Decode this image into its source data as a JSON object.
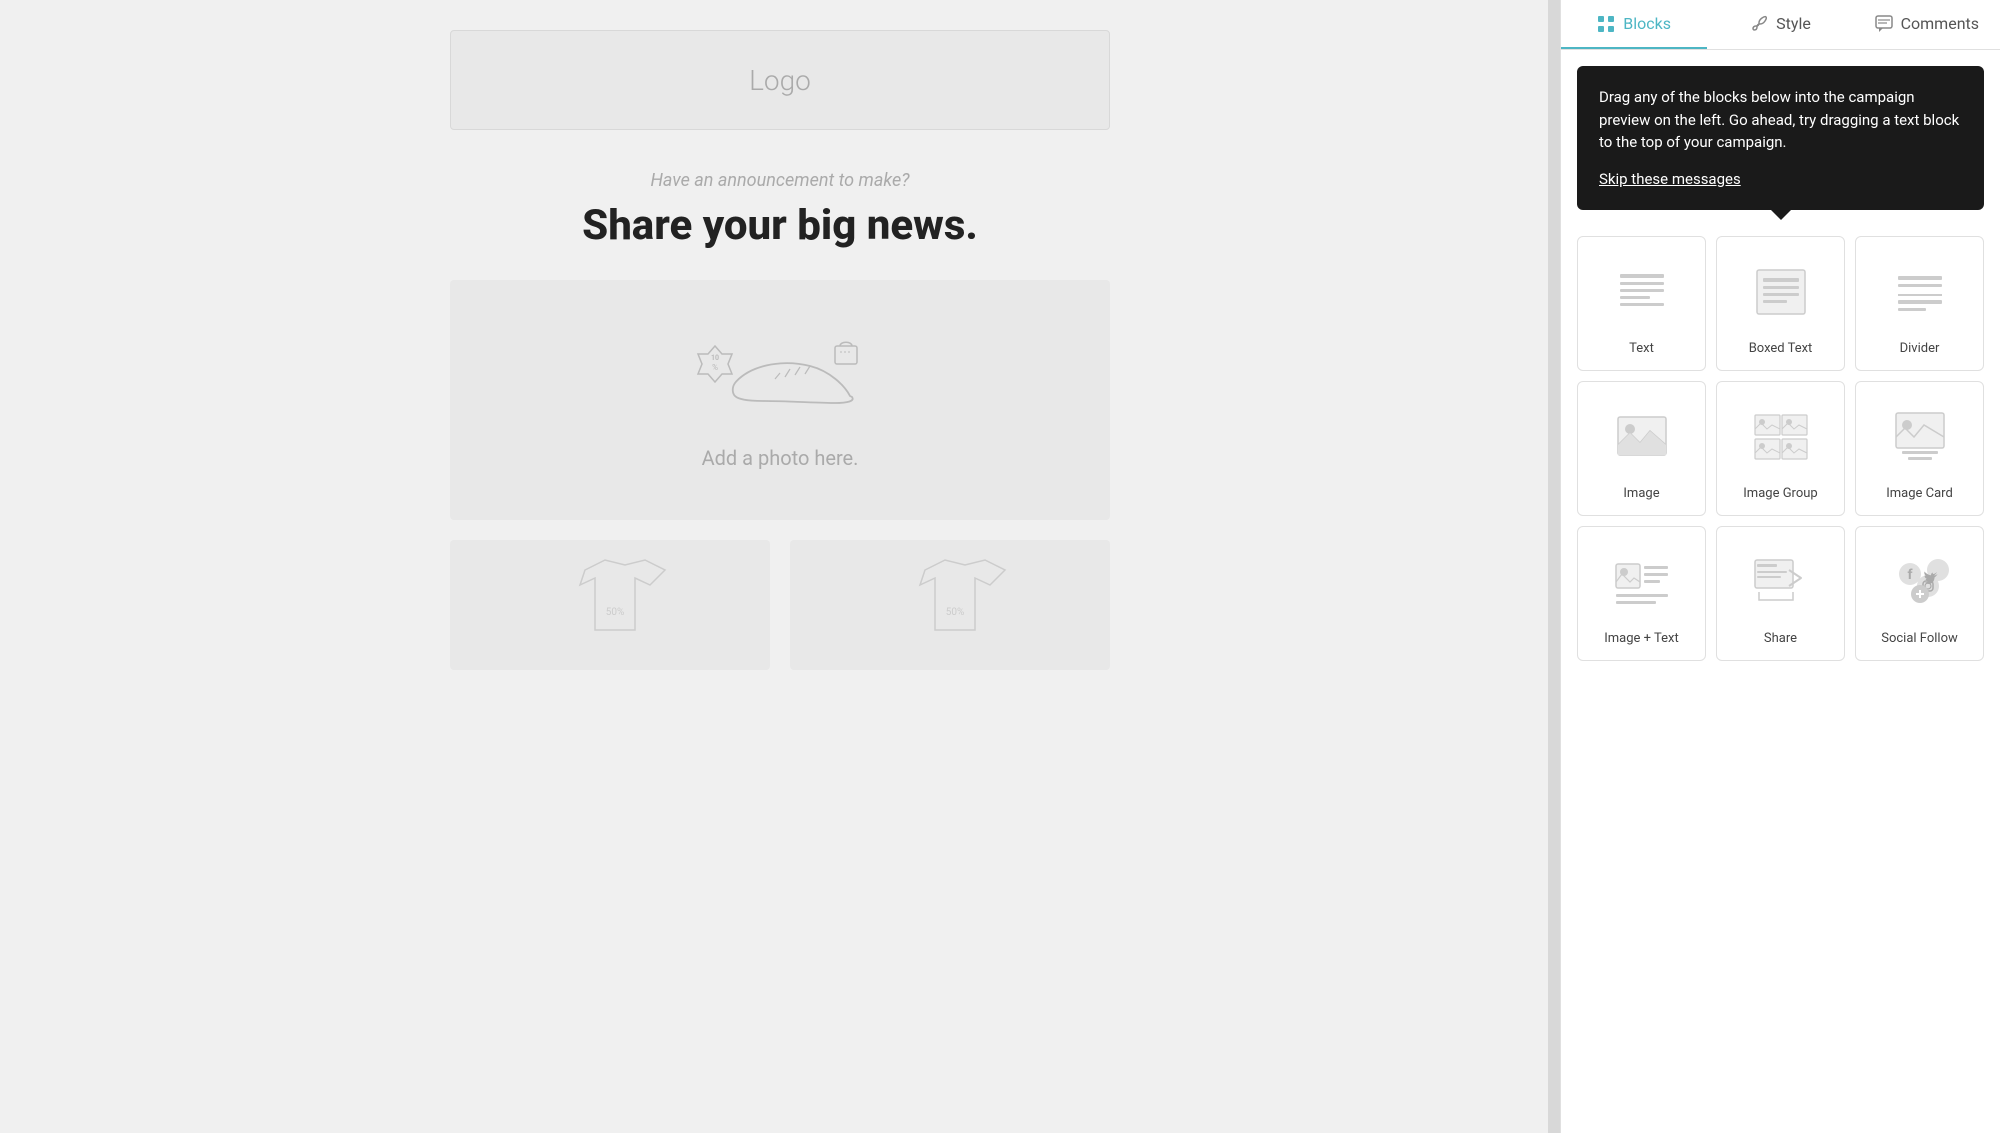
{
  "tabs": [
    {
      "id": "blocks",
      "label": "Blocks",
      "icon": "grid",
      "active": true
    },
    {
      "id": "style",
      "label": "Style",
      "icon": "paint"
    },
    {
      "id": "comments",
      "label": "Comments",
      "icon": "comment"
    }
  ],
  "tooltip": {
    "message": "Drag any of the blocks below into the campaign preview on the left. Go ahead, try dragging a text block to the top of your campaign.",
    "skip_label": "Skip these messages"
  },
  "blocks": [
    {
      "id": "text",
      "label": "Text"
    },
    {
      "id": "boxed-text",
      "label": "Boxed Text"
    },
    {
      "id": "divider",
      "label": "Divider"
    },
    {
      "id": "image",
      "label": "Image"
    },
    {
      "id": "image-group",
      "label": "Image Group"
    },
    {
      "id": "image-card",
      "label": "Image Card"
    },
    {
      "id": "image-text",
      "label": "Image + Text"
    },
    {
      "id": "share",
      "label": "Share"
    },
    {
      "id": "social-follow",
      "label": "Social Follow"
    }
  ],
  "preview": {
    "logo_text": "Logo",
    "announcement_subtitle": "Have an announcement to make?",
    "announcement_title": "Share your big news.",
    "photo_placeholder": "Add a photo here.",
    "colors": {
      "active_tab": "#4db6c4"
    }
  }
}
